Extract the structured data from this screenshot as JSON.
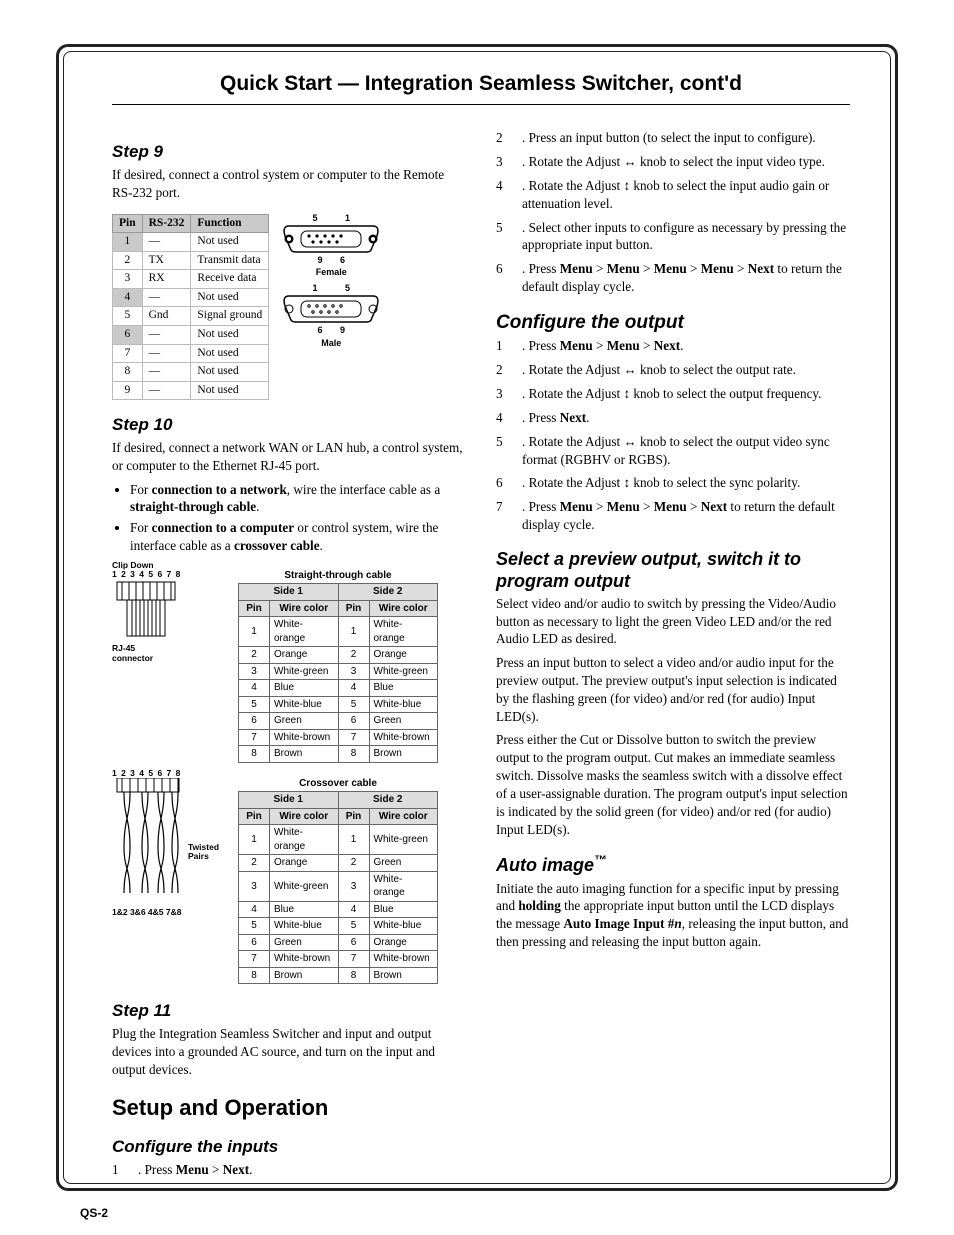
{
  "page": {
    "title": "Quick Start — Integration Seamless Switcher, cont'd",
    "footer": "QS-2"
  },
  "left": {
    "step9": {
      "heading": "Step 9",
      "text": "If desired, connect a control system or computer to the Remote RS-232 port.",
      "pin_headers": [
        "Pin",
        "RS-232",
        "Function"
      ],
      "pins": [
        {
          "pin": "1",
          "rs232": "—",
          "func": "Not used"
        },
        {
          "pin": "2",
          "rs232": "TX",
          "func": "Transmit data"
        },
        {
          "pin": "3",
          "rs232": "RX",
          "func": "Receive data"
        },
        {
          "pin": "4",
          "rs232": "—",
          "func": "Not used"
        },
        {
          "pin": "5",
          "rs232": "Gnd",
          "func": "Signal ground"
        },
        {
          "pin": "6",
          "rs232": "—",
          "func": "Not used"
        },
        {
          "pin": "7",
          "rs232": "—",
          "func": "Not used"
        },
        {
          "pin": "8",
          "rs232": "—",
          "func": "Not used"
        },
        {
          "pin": "9",
          "rs232": "—",
          "func": "Not used"
        }
      ],
      "conn_top_nums": {
        "l": "5",
        "r": "1",
        "lb": "9",
        "rb": "6"
      },
      "conn_female": "Female",
      "conn_bot_nums": {
        "l": "1",
        "r": "5",
        "lb": "6",
        "rb": "9"
      },
      "conn_male": "Male"
    },
    "step10": {
      "heading": "Step 10",
      "p1": "If desired, connect a network WAN or LAN hub, a control system, or computer to the Ethernet RJ-45 port.",
      "bullet1a": "For ",
      "bullet1b": "connection to a network",
      "bullet1c": ", wire the interface cable as a ",
      "bullet1d": "straight-through cable",
      "bullet1e": ".",
      "bullet2a": "For ",
      "bullet2b": "connection to a computer",
      "bullet2c": " or control system, wire the interface cable as a ",
      "bullet2d": "crossover cable",
      "bullet2e": ".",
      "rj45_label1": "Clip Down",
      "rj45_nums": "1 2 3 4 5 6 7 8",
      "rj45_conn": "RJ-45\nconnector",
      "twisted": "Twisted\nPairs",
      "pairs_bottom": "1&2  3&6 4&5 7&8",
      "straight_title": "Straight-through cable",
      "crossover_title": "Crossover cable",
      "side1": "Side 1",
      "side2": "Side 2",
      "col_pin": "Pin",
      "col_wire": "Wire color",
      "straight_rows": [
        [
          "1",
          "White-orange",
          "1",
          "White-orange"
        ],
        [
          "2",
          "Orange",
          "2",
          "Orange"
        ],
        [
          "3",
          "White-green",
          "3",
          "White-green"
        ],
        [
          "4",
          "Blue",
          "4",
          "Blue"
        ],
        [
          "5",
          "White-blue",
          "5",
          "White-blue"
        ],
        [
          "6",
          "Green",
          "6",
          "Green"
        ],
        [
          "7",
          "White-brown",
          "7",
          "White-brown"
        ],
        [
          "8",
          "Brown",
          "8",
          "Brown"
        ]
      ],
      "crossover_rows": [
        [
          "1",
          "White-orange",
          "1",
          "White-green"
        ],
        [
          "2",
          "Orange",
          "2",
          "Green"
        ],
        [
          "3",
          "White-green",
          "3",
          "White-orange"
        ],
        [
          "4",
          "Blue",
          "4",
          "Blue"
        ],
        [
          "5",
          "White-blue",
          "5",
          "White-blue"
        ],
        [
          "6",
          "Green",
          "6",
          "Orange"
        ],
        [
          "7",
          "White-brown",
          "7",
          "White-brown"
        ],
        [
          "8",
          "Brown",
          "8",
          "Brown"
        ]
      ]
    },
    "step11": {
      "heading": "Step 11",
      "text": "Plug the Integration Seamless Switcher and input and output devices into a grounded AC source, and turn on the input and output devices."
    },
    "setup_head": "Setup and Operation",
    "configure_inputs": {
      "heading": "Configure the inputs",
      "item1_pre": "Press ",
      "item1_menu": "Menu",
      "item1_gt": " > ",
      "item1_next": "Next",
      "item1_end": "."
    }
  },
  "right": {
    "inputs_cont": {
      "i2": "Press an input button (to select the input to configure).",
      "i3a": "Rotate the Adjust ",
      "i3b": " knob to select the input video type.",
      "i4a": "Rotate the Adjust ",
      "i4b": " knob to select the input audio gain or attenuation level.",
      "i5": "Select other inputs to configure as necessary by pressing the appropriate input button.",
      "i6a": "Press ",
      "i6_menu": "Menu",
      "i6_gt": " > ",
      "i6_next": "Next",
      "i6b": " to return the default display cycle."
    },
    "configure_output": {
      "heading": "Configure the output",
      "o1a": "Press ",
      "o1_menu": "Menu",
      "o1_gt": " > ",
      "o1_next": "Next",
      "o1_end": ".",
      "o2a": "Rotate the Adjust ",
      "o2b": " knob to select the output rate.",
      "o3a": "Rotate the Adjust ",
      "o3b": " knob to select the output frequency.",
      "o4a": "Press ",
      "o4_next": "Next",
      "o4_end": ".",
      "o5a": "Rotate the Adjust ",
      "o5b": " knob to select the output video sync format (RGBHV or RGBS).",
      "o6a": "Rotate the Adjust ",
      "o6b": " knob to select the sync polarity.",
      "o7a": "Press ",
      "o7_menu": "Menu",
      "o7_gt": " > ",
      "o7_next": "Next",
      "o7b": " to return the default display cycle."
    },
    "preview": {
      "heading": "Select a preview output, switch it to program output",
      "p1": "Select video and/or audio to switch by pressing the Video/Audio button as necessary to light the green Video LED and/or the red Audio LED as desired.",
      "p2": "Press an input button to select a video and/or audio input for the preview output.  The preview output's input selection is indicated by the flashing green (for video) and/or red (for audio) Input LED(s).",
      "p3": "Press either the Cut or Dissolve button to switch the preview output to the program output.  Cut makes an immediate seamless switch.  Dissolve masks the seamless switch with a dissolve effect of a user-assignable duration.  The program output's input selection is indicated by the solid green (for video) and/or red (for audio) Input LED(s)."
    },
    "autoimage": {
      "heading": "Auto image",
      "tm": "™",
      "p_a": "Initiate the auto imaging function for a specific input by pressing and ",
      "p_b": "holding",
      "p_c": " the appropriate input button until the LCD displays the message ",
      "p_d": "Auto Image Input #",
      "p_e": "n",
      "p_f": ", releasing the input button, and then pressing and releasing the input button again."
    }
  }
}
